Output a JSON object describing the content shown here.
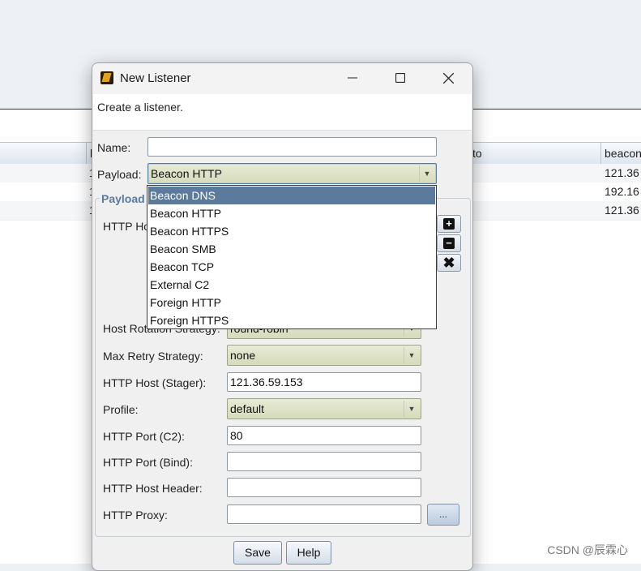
{
  "background": {
    "columns": [
      "h",
      "to",
      "beacon"
    ],
    "rows": [
      {
        "col1": "1",
        "col3": "121.36"
      },
      {
        "col1": "1",
        "col3": "192.16"
      },
      {
        "col1": "1",
        "col3": "121.36"
      }
    ]
  },
  "dialog": {
    "title": "New Listener",
    "description": "Create a listener.",
    "name_label": "Name:",
    "name_value": "",
    "payload_label": "Payload:",
    "payload_value": "Beacon HTTP",
    "section_title": "Payload",
    "fields": {
      "http_hosts_label": "HTTP Ho",
      "host_rotation_label": "Host Rotation Strategy:",
      "host_rotation_value": "round-robin",
      "max_retry_label": "Max Retry Strategy:",
      "max_retry_value": "none",
      "http_host_stager_label": "HTTP Host (Stager):",
      "http_host_stager_value": "121.36.59.153",
      "profile_label": "Profile:",
      "profile_value": "default",
      "http_port_c2_label": "HTTP Port (C2):",
      "http_port_c2_value": "80",
      "http_port_bind_label": "HTTP Port (Bind):",
      "http_port_bind_value": "",
      "http_host_header_label": "HTTP Host Header:",
      "http_host_header_value": "",
      "http_proxy_label": "HTTP Proxy:",
      "http_proxy_value": "",
      "proxy_button_label": "..."
    },
    "buttons": {
      "save": "Save",
      "help": "Help"
    }
  },
  "payload_dropdown": {
    "selected_index": 0,
    "options": [
      "Beacon DNS",
      "Beacon HTTP",
      "Beacon HTTPS",
      "Beacon SMB",
      "Beacon TCP",
      "External C2",
      "Foreign HTTP",
      "Foreign HTTPS"
    ]
  },
  "watermark": "CSDN @辰霖心",
  "colors": {
    "selection": "#5c7a9b",
    "combo_fill": "#d5dbbb",
    "section_title": "#5a7a9e"
  }
}
